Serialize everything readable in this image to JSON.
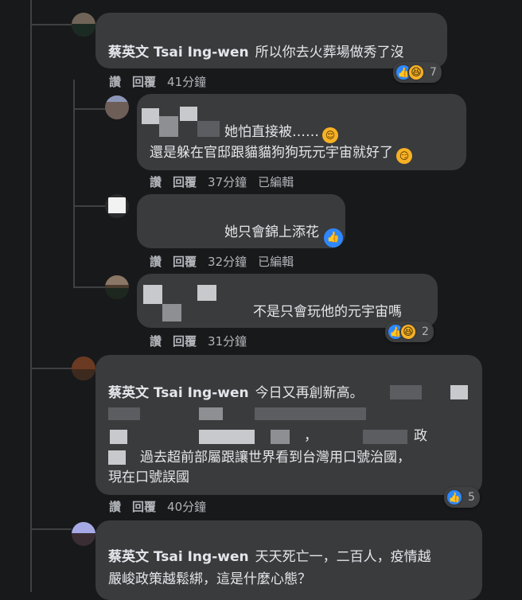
{
  "comments": [
    {
      "author": "蔡英文 Tsai Ing-wen",
      "text": "所以你去火葬場做秀了沒",
      "actions": {
        "like": "讚",
        "reply": "回覆",
        "time": "41分鐘"
      },
      "reactions": {
        "count": "7",
        "types": [
          "like-icon",
          "haha-icon"
        ]
      }
    },
    {
      "lines": [
        "她怕直接被……",
        "還是躲在官邸跟貓貓狗狗玩元宇宙就好了"
      ],
      "actions": {
        "like": "讚",
        "reply": "回覆",
        "time": "37分鐘",
        "edited": "已編輯"
      }
    },
    {
      "text": "她只會錦上添花",
      "actions": {
        "like": "讚",
        "reply": "回覆",
        "time": "32分鐘",
        "edited": "已編輯"
      }
    },
    {
      "text": "不是只會玩他的元宇宙嗎",
      "actions": {
        "like": "讚",
        "reply": "回覆",
        "time": "31分鐘"
      },
      "reactions": {
        "count": "2",
        "types": [
          "like-icon",
          "haha-icon"
        ]
      }
    },
    {
      "author": "蔡英文 Tsai Ing-wen",
      "line1": "今日又再創新高。",
      "line2": "，",
      "line3": "政",
      "line4": "過去超前部屬跟讓世界看到台灣用口號治國，",
      "line5": "現在口號誤國",
      "actions": {
        "like": "讚",
        "reply": "回覆",
        "time": "40分鐘"
      },
      "reactions": {
        "count": "5",
        "types": [
          "like-icon"
        ]
      }
    },
    {
      "author": "蔡英文 Tsai Ing-wen",
      "line1": "天天死亡一，二百人，疫情越",
      "line2": "嚴峻政策越鬆綁，這是什麼心態？"
    }
  ],
  "colors": {
    "background": "#18191a",
    "bubble": "#3a3b3c",
    "like": "#2d88ff",
    "haha": "#f7b125"
  }
}
